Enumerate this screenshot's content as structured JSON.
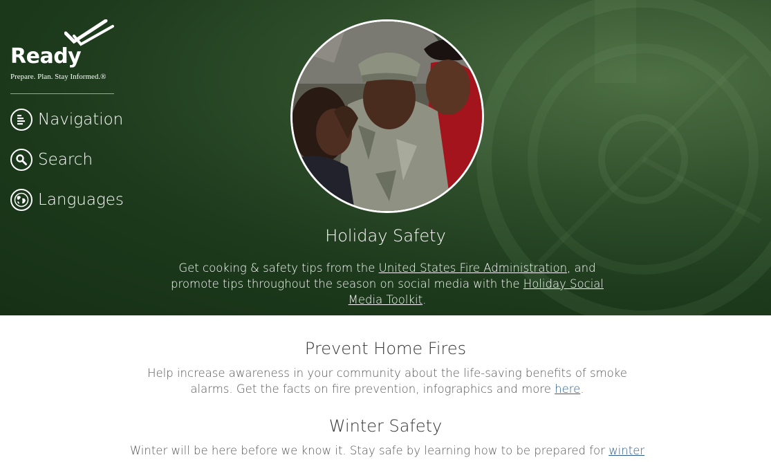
{
  "brand": {
    "name": "Ready",
    "tagline": "Prepare. Plan. Stay Informed.®"
  },
  "nav": [
    {
      "label": "Navigation",
      "icon": "list-icon"
    },
    {
      "label": "Search",
      "icon": "search-icon"
    },
    {
      "label": "Languages",
      "icon": "globe-icon"
    }
  ],
  "hero": {
    "title": "Holiday Safety",
    "text_1": "Get cooking & safety tips from the ",
    "link_1": "United States Fire Administration",
    "text_2": ", and promote tips throughout the season on social media with the ",
    "link_2": "Holiday Social Media Toolkit",
    "text_3": "."
  },
  "sections": [
    {
      "title": "Prevent Home Fires",
      "text": "Help increase awareness in your community about the life-saving benefits of smoke alarms. Get the facts on fire prevention, infographics and more ",
      "link": "here",
      "tail": "."
    },
    {
      "title": "Winter Safety",
      "text": "Winter will be here before we know it.  Stay safe by learning how to be prepared for ",
      "link": "winter"
    }
  ],
  "colors": {
    "hero_green": "#1d3a1c",
    "link_blue": "#2b5c8a",
    "text_gray": "#555555"
  }
}
